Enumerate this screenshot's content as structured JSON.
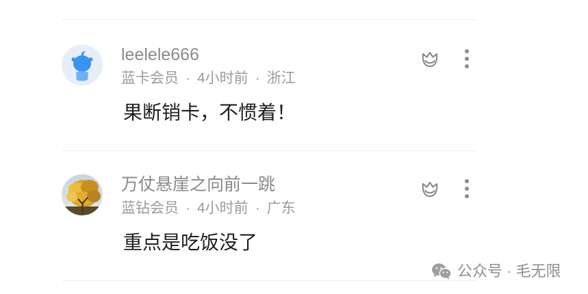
{
  "meta_separator": "·",
  "comments": [
    {
      "username": "leelele666",
      "membership": "蓝卡会员",
      "time": "4小时前",
      "location": "浙江",
      "text": "果断销卡，不惯着！"
    },
    {
      "username": "万仗悬崖之向前一跳",
      "membership": "蓝钻会员",
      "time": "4小时前",
      "location": "广东",
      "text": "重点是吃饭没了"
    }
  ],
  "icons": {
    "like": "like-icon",
    "more": "more-vertical-icon",
    "watermark": "wechat-icon"
  },
  "watermark": {
    "text": "公众号 · 毛无限"
  },
  "colors": {
    "username": "#8a8a8a",
    "meta": "#9b9b9b",
    "text": "#1f1f1f",
    "divider": "#efefef",
    "icon": "#8c8c8c",
    "watermark": "#8f8f8f"
  }
}
